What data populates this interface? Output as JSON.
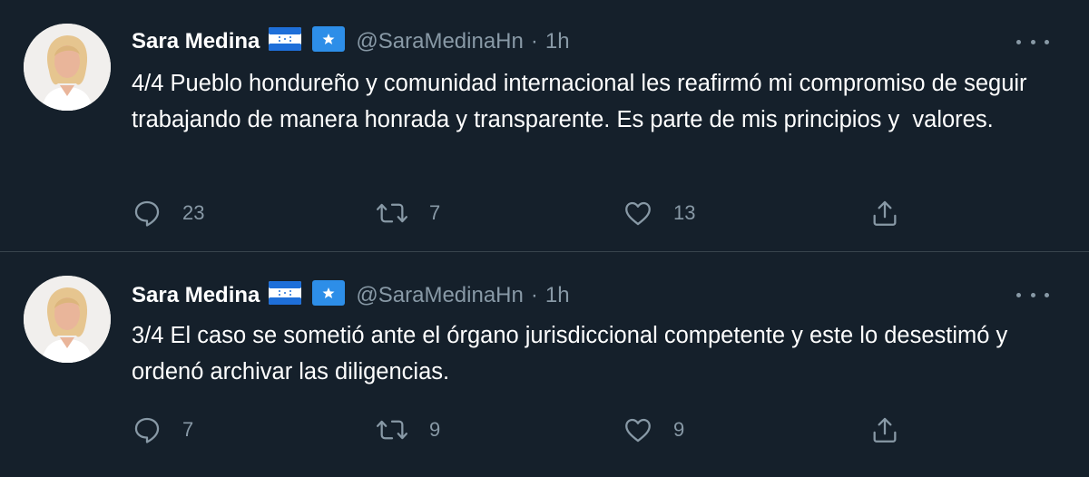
{
  "colors": {
    "background": "#15202b",
    "divider": "#38444d",
    "text": "#ffffff",
    "muted": "#8899a6"
  },
  "tweets": [
    {
      "author": {
        "name": "Sara Medina",
        "handle": "@SaraMedinaHn",
        "badges": [
          "honduras-flag-icon",
          "star-badge-icon"
        ]
      },
      "separator": "·",
      "time": "1h",
      "text": "4/4 Pueblo hondureño y comunidad internacional les reafirmó mi compromiso de seguir trabajando de manera honrada y transparente. Es parte de mis principios y  valores.",
      "replies": "23",
      "retweets": "7",
      "likes": "13"
    },
    {
      "author": {
        "name": "Sara Medina",
        "handle": "@SaraMedinaHn",
        "badges": [
          "honduras-flag-icon",
          "star-badge-icon"
        ]
      },
      "separator": "·",
      "time": "1h",
      "text": "3/4 El caso se sometió ante el órgano jurisdiccional competente y este lo desestimó y ordenó archivar las diligencias.",
      "replies": "7",
      "retweets": "9",
      "likes": "9"
    }
  ]
}
